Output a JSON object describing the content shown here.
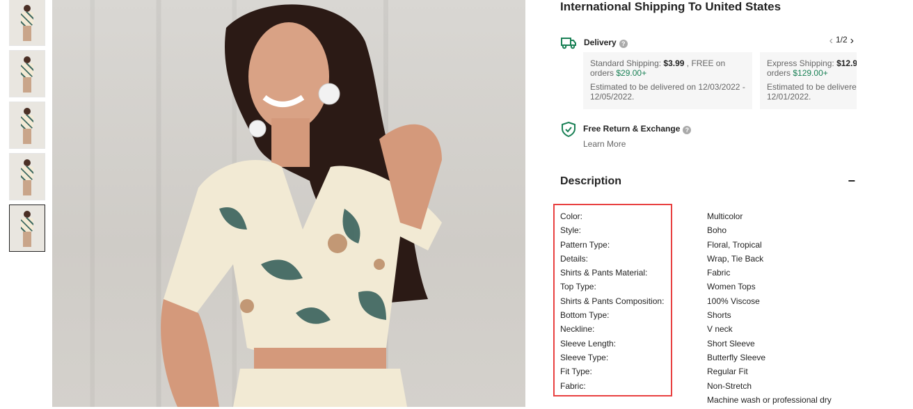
{
  "thumbnails": [
    {
      "alt": "thumbnail 1"
    },
    {
      "alt": "thumbnail 2"
    },
    {
      "alt": "thumbnail 3"
    },
    {
      "alt": "thumbnail 4"
    },
    {
      "alt": "thumbnail 5"
    }
  ],
  "shipping": {
    "title": "International Shipping To United States",
    "delivery_label": "Delivery",
    "pager": "1/2",
    "options": [
      {
        "prefix": "Standard Shipping: ",
        "price": "$3.99",
        "mid": " , FREE on orders ",
        "threshold": "$29.00+",
        "estimate": "Estimated to be delivered on 12/03/2022 - 12/05/2022."
      },
      {
        "prefix": "Express Shipping: ",
        "price": "$12.9",
        "mid": " orders ",
        "threshold": "$129.00+",
        "estimate": "Estimated to be delivere - 12/01/2022."
      }
    ],
    "return_label": "Free Return & Exchange",
    "learn_more": "Learn More"
  },
  "description": {
    "title": "Description",
    "collapse_symbol": "−",
    "attributes": [
      {
        "label": "Color:",
        "value": "Multicolor"
      },
      {
        "label": "Style:",
        "value": "Boho"
      },
      {
        "label": "Pattern Type:",
        "value": "Floral, Tropical"
      },
      {
        "label": "Details:",
        "value": "Wrap, Tie Back"
      },
      {
        "label": "Shirts & Pants Material:",
        "value": "Fabric"
      },
      {
        "label": "Top Type:",
        "value": "Women Tops"
      },
      {
        "label": "Shirts & Pants Composition:",
        "value": "100% Viscose"
      },
      {
        "label": "Bottom Type:",
        "value": "Shorts"
      },
      {
        "label": "Neckline:",
        "value": "V neck"
      },
      {
        "label": "Sleeve Length:",
        "value": "Short Sleeve"
      },
      {
        "label": "Sleeve Type:",
        "value": "Butterfly Sleeve"
      },
      {
        "label": "Fit Type:",
        "value": "Regular Fit"
      },
      {
        "label": "Fabric:",
        "value": "Non-Stretch"
      },
      {
        "label": "",
        "value": "Machine wash or professional dry"
      }
    ]
  },
  "colors": {
    "accent_green": "#198055",
    "highlight_red": "#e84040"
  }
}
